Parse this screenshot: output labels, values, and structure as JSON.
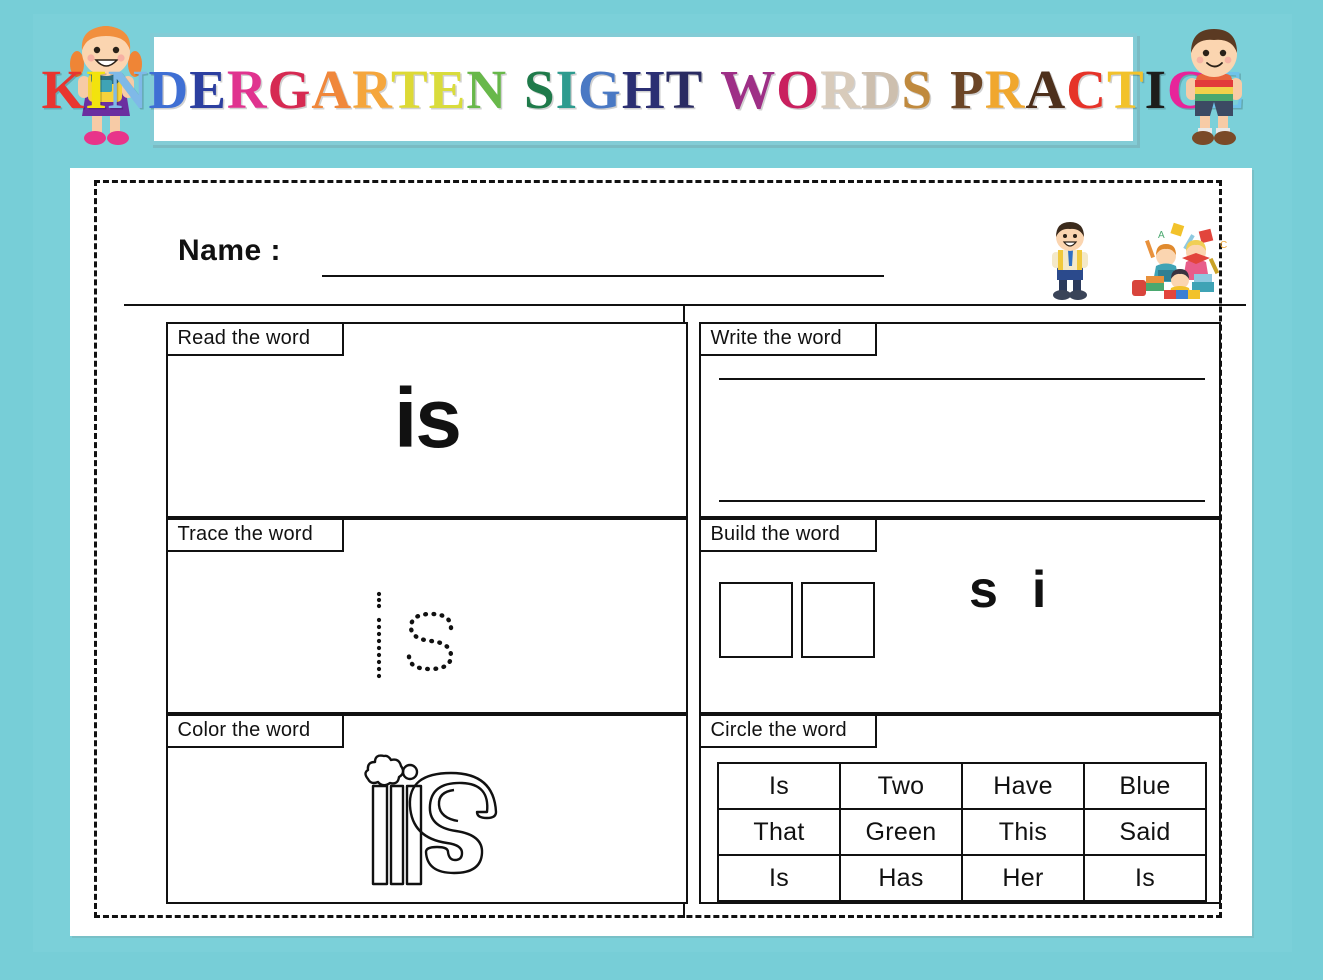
{
  "theme": {
    "background": "#77ced7",
    "plate": "#7fd2da",
    "sheet": "#ffffff",
    "ink": "#111111",
    "banner_border": "#83ccd6"
  },
  "header": {
    "title_letters": [
      {
        "ch": "K",
        "color": "#e8352f"
      },
      {
        "ch": "I",
        "color": "#f2e30d"
      },
      {
        "ch": "N",
        "color": "#7fb9e8"
      },
      {
        "ch": "D",
        "color": "#3f6fd4"
      },
      {
        "ch": "E",
        "color": "#2c3fa0"
      },
      {
        "ch": "R",
        "color": "#e0338f"
      },
      {
        "ch": "G",
        "color": "#d62a52"
      },
      {
        "ch": "A",
        "color": "#f0873b"
      },
      {
        "ch": "R",
        "color": "#f5a63c"
      },
      {
        "ch": "T",
        "color": "#ddd935"
      },
      {
        "ch": "E",
        "color": "#d9dc3c"
      },
      {
        "ch": "N",
        "color": "#68b84a"
      },
      {
        "ch": " ",
        "color": ""
      },
      {
        "ch": "S",
        "color": "#1f7a4a"
      },
      {
        "ch": "I",
        "color": "#2e9b8f"
      },
      {
        "ch": "G",
        "color": "#4a79c4"
      },
      {
        "ch": "H",
        "color": "#2b2f73"
      },
      {
        "ch": "T",
        "color": "#2a2b62"
      },
      {
        "ch": " ",
        "color": ""
      },
      {
        "ch": "W",
        "color": "#9e2f86"
      },
      {
        "ch": "O",
        "color": "#c9205e"
      },
      {
        "ch": "R",
        "color": "#d8cbbb"
      },
      {
        "ch": "D",
        "color": "#cdbfae"
      },
      {
        "ch": "S",
        "color": "#c08a3e"
      },
      {
        "ch": " ",
        "color": ""
      },
      {
        "ch": "P",
        "color": "#6b4526"
      },
      {
        "ch": "R",
        "color": "#f0a72e"
      },
      {
        "ch": "A",
        "color": "#4d2f1b"
      },
      {
        "ch": "C",
        "color": "#e63329"
      },
      {
        "ch": "T",
        "color": "#f2c22b"
      },
      {
        "ch": "I",
        "color": "#1d1d1b"
      },
      {
        "ch": "C",
        "color": "#e8249a"
      },
      {
        "ch": "E",
        "color": "#6ec3ea"
      }
    ],
    "title_plain": "KINDERGARTEN SIGHT WORDS PRACTICE",
    "left_illustration": "girl-with-backpack-illustration",
    "right_illustration": "boy-with-books-illustration"
  },
  "worksheet": {
    "name_label": "Name :",
    "name_value": "",
    "name_placeholder": "",
    "illustration_boy": "schoolboy-uniform-illustration",
    "illustration_group": "kids-reading-illustration",
    "word": "is",
    "activities": {
      "read": {
        "label": "Read the word",
        "word": "is"
      },
      "trace": {
        "label": "Trace the word",
        "word": "is"
      },
      "color": {
        "label": "Color the word",
        "word": "is"
      },
      "write": {
        "label": "Write the word",
        "lines": 2,
        "value": ""
      },
      "build": {
        "label": "Build the word",
        "empty_boxes": 2,
        "scrambled_letters": [
          "s",
          "i"
        ]
      },
      "circle": {
        "label": "Circle the word",
        "grid": [
          [
            "Is",
            "Two",
            "Have",
            "Blue"
          ],
          [
            "That",
            "Green",
            "This",
            "Said"
          ],
          [
            "Is",
            "Has",
            "Her",
            "Is"
          ]
        ]
      }
    }
  }
}
